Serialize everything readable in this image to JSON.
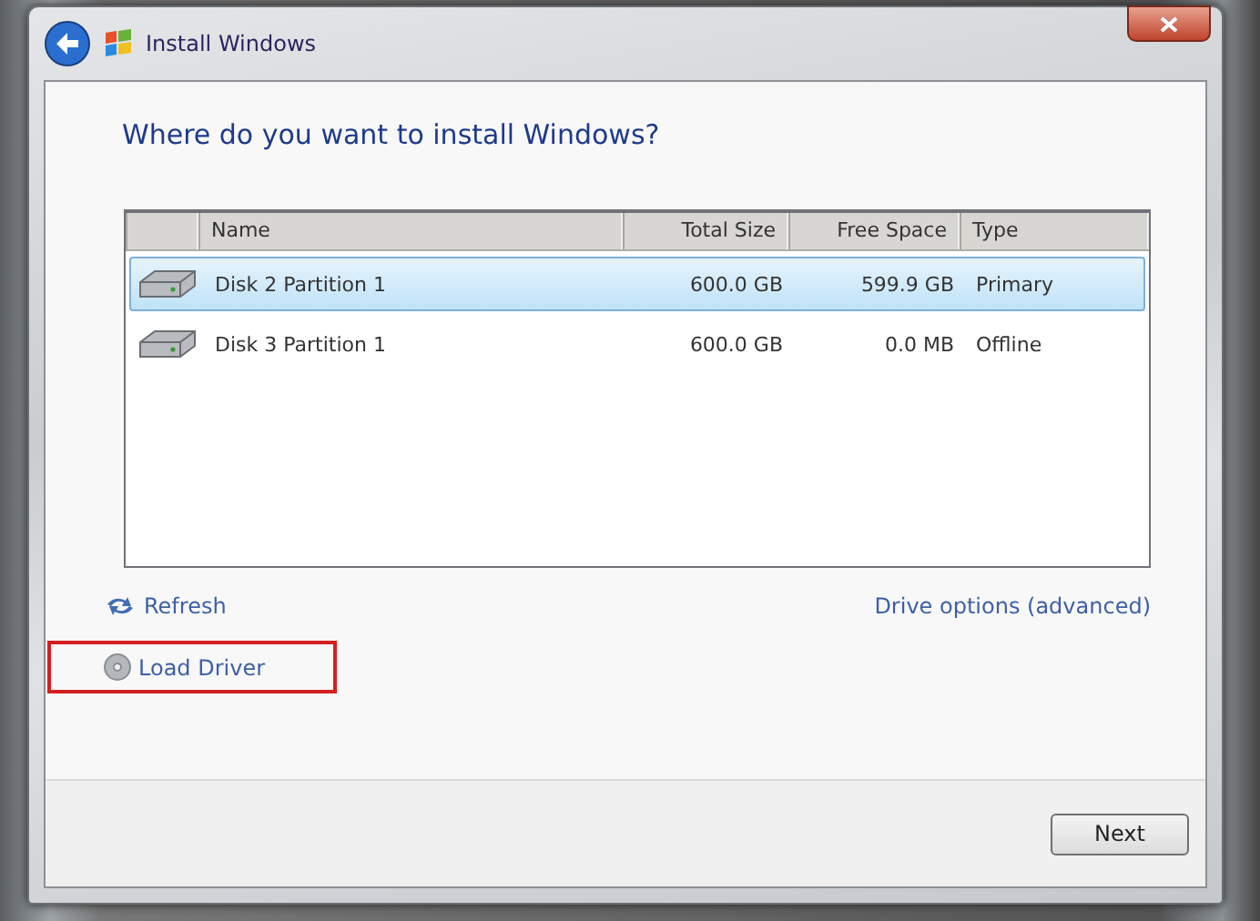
{
  "window": {
    "title": "Install Windows"
  },
  "heading": "Where do you want to install Windows?",
  "table": {
    "columns": [
      "Name",
      "Total Size",
      "Free Space",
      "Type"
    ],
    "rows": [
      {
        "name": "Disk 2 Partition 1",
        "total_size": "600.0 GB",
        "free_space": "599.9 GB",
        "type": "Primary",
        "selected": true
      },
      {
        "name": "Disk 3 Partition 1",
        "total_size": "600.0 GB",
        "free_space": "0.0 MB",
        "type": "Offline",
        "selected": false
      }
    ]
  },
  "links": [
    {
      "kind": "refresh",
      "label": "Refresh",
      "highlighted": false
    },
    {
      "kind": "drive-options",
      "label": "Drive options (advanced)",
      "highlighted": false
    },
    {
      "kind": "load-driver",
      "label": "Load Driver",
      "highlighted": true
    }
  ],
  "buttons": [
    {
      "label": "Next"
    }
  ]
}
